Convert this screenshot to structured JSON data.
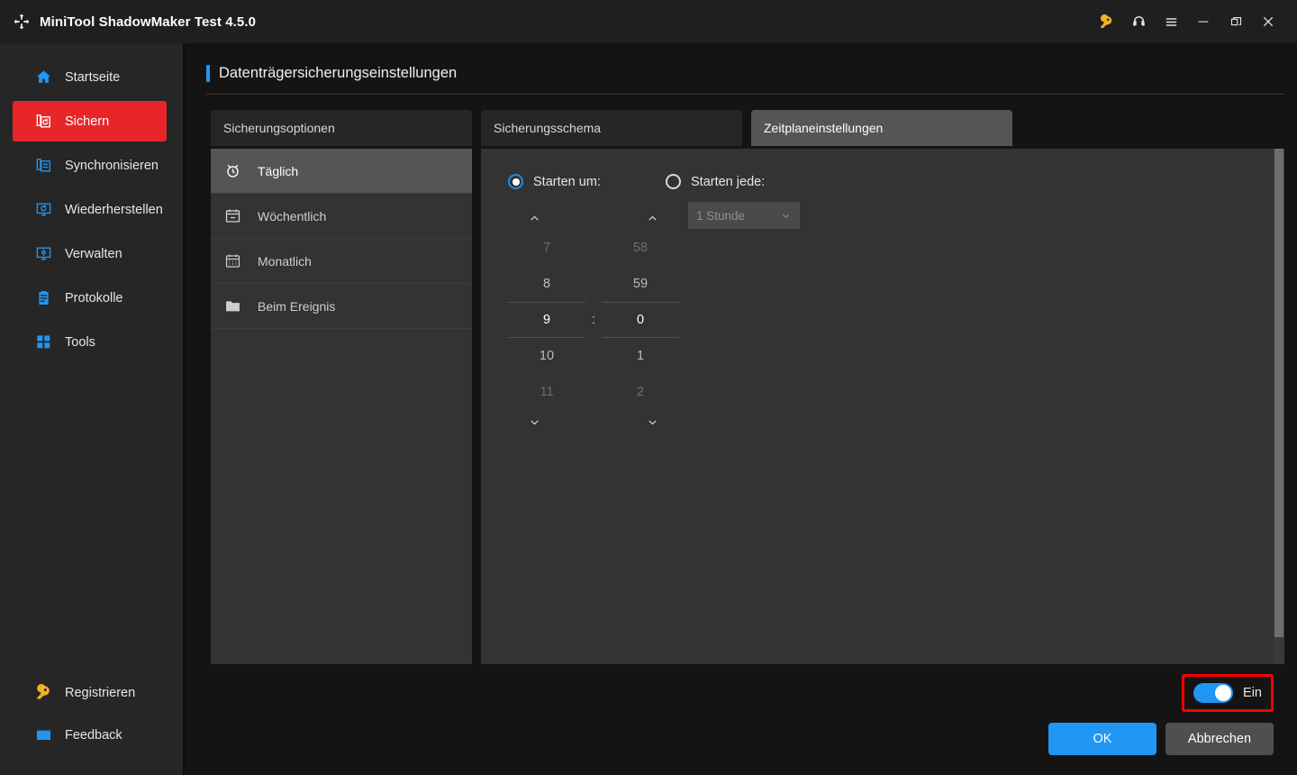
{
  "titlebar": {
    "app_title": "MiniTool ShadowMaker Test 4.5.0",
    "logo_icon": "shadowmaker-logo-icon",
    "buttons": [
      {
        "name": "key-icon",
        "label": ""
      },
      {
        "name": "headphones-icon",
        "label": ""
      },
      {
        "name": "hamburger-menu-icon",
        "label": ""
      },
      {
        "name": "minimize-icon",
        "label": ""
      },
      {
        "name": "restore-icon",
        "label": ""
      },
      {
        "name": "close-icon",
        "label": ""
      }
    ]
  },
  "sidebar": {
    "items": [
      {
        "label": "Startseite",
        "icon": "home-icon",
        "active": false
      },
      {
        "label": "Sichern",
        "icon": "backup-icon",
        "active": true
      },
      {
        "label": "Synchronisieren",
        "icon": "sync-icon",
        "active": false
      },
      {
        "label": "Wiederherstellen",
        "icon": "restore-monitor-icon",
        "active": false
      },
      {
        "label": "Verwalten",
        "icon": "manage-gear-monitor-icon",
        "active": false
      },
      {
        "label": "Protokolle",
        "icon": "logs-clipboard-icon",
        "active": false
      },
      {
        "label": "Tools",
        "icon": "tools-grid-icon",
        "active": false
      }
    ],
    "bottom_items": [
      {
        "label": "Registrieren",
        "icon": "key-icon"
      },
      {
        "label": "Feedback",
        "icon": "mail-icon"
      }
    ]
  },
  "page": {
    "title": "Datenträgersicherungseinstellungen"
  },
  "tabs": [
    {
      "label": "Sicherungsoptionen",
      "active": false
    },
    {
      "label": "Sicherungsschema",
      "active": false
    },
    {
      "label": "Zeitplaneinstellungen",
      "active": true
    }
  ],
  "schedule_types": [
    {
      "label": "Täglich",
      "icon": "alarm-clock-icon",
      "active": true
    },
    {
      "label": "Wöchentlich",
      "icon": "calendar-icon",
      "active": false
    },
    {
      "label": "Monatlich",
      "icon": "calendar-month-icon",
      "active": false
    },
    {
      "label": "Beim Ereignis",
      "icon": "folder-icon",
      "active": false
    }
  ],
  "schedule_settings": {
    "start_at": {
      "label": "Starten um:",
      "selected": true
    },
    "start_every": {
      "label": "Starten jede:",
      "selected": false
    },
    "interval_select": {
      "value": "1 Stunde",
      "disabled": true,
      "chevron": "chevron-down-icon"
    },
    "time_picker": {
      "separator": ":",
      "hours": [
        {
          "value": "7",
          "state": "far"
        },
        {
          "value": "8",
          "state": "near"
        },
        {
          "value": "9",
          "state": "selected"
        },
        {
          "value": "10",
          "state": "near"
        },
        {
          "value": "11",
          "state": "far"
        }
      ],
      "minutes": [
        {
          "value": "58",
          "state": "far"
        },
        {
          "value": "59",
          "state": "near"
        },
        {
          "value": "0",
          "state": "selected"
        },
        {
          "value": "1",
          "state": "near"
        },
        {
          "value": "2",
          "state": "far"
        }
      ],
      "up_arrow": "chevron-up-icon",
      "down_arrow": "chevron-down-icon"
    }
  },
  "footer": {
    "toggle": {
      "label": "Ein",
      "on": true
    },
    "ok_label": "OK",
    "cancel_label": "Abbrechen"
  },
  "colors": {
    "accent_blue": "#2196f3",
    "active_red": "#e8262a",
    "gold": "#f0b429",
    "annotation_red": "#ff0000",
    "panel_bg": "#333333",
    "window_bg": "#141414",
    "sidebar_bg": "#262626"
  }
}
